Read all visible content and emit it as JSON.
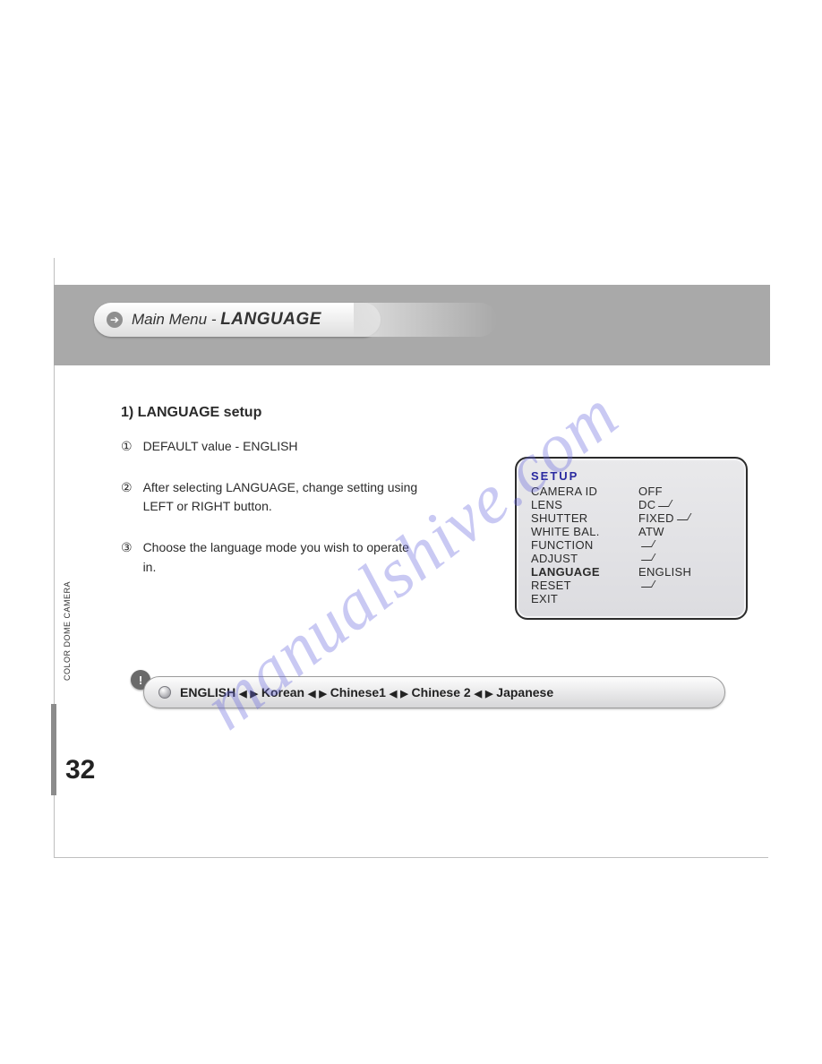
{
  "header": {
    "prefix": "Main Menu - ",
    "title": "LANGUAGE"
  },
  "section": {
    "title": "1)  LANGUAGE setup"
  },
  "steps": [
    {
      "num": "①",
      "text": "DEFAULT value - ENGLISH"
    },
    {
      "num": "②",
      "text": "After selecting LANGUAGE, change setting using LEFT or RIGHT button."
    },
    {
      "num": "③",
      "text": "Choose the language mode you wish to operate in."
    }
  ],
  "osd": {
    "title": "SETUP",
    "rows": [
      {
        "k": "CAMERA ID",
        "v": "OFF",
        "enter": false,
        "bold": false
      },
      {
        "k": "LENS",
        "v": "DC",
        "enter": true,
        "bold": false
      },
      {
        "k": "SHUTTER",
        "v": "FIXED",
        "enter": true,
        "bold": false
      },
      {
        "k": "WHITE BAL.",
        "v": "ATW",
        "enter": false,
        "bold": false
      },
      {
        "k": "FUNCTION",
        "v": "",
        "enter": true,
        "bold": false
      },
      {
        "k": "ADJUST",
        "v": "",
        "enter": true,
        "bold": false
      },
      {
        "k": "LANGUAGE",
        "v": "ENGLISH",
        "enter": false,
        "bold": true
      },
      {
        "k": "RESET",
        "v": "",
        "enter": true,
        "bold": false
      },
      {
        "k": "EXIT",
        "v": "",
        "enter": false,
        "bold": false
      }
    ]
  },
  "langbar": {
    "items": [
      "ENGLISH",
      "Korean",
      "Chinese1",
      "Chinese 2",
      "Japanese"
    ]
  },
  "side_label": "COLOR DOME CAMERA",
  "page_number": "32",
  "watermark": "manualshive.com",
  "bang": "!"
}
